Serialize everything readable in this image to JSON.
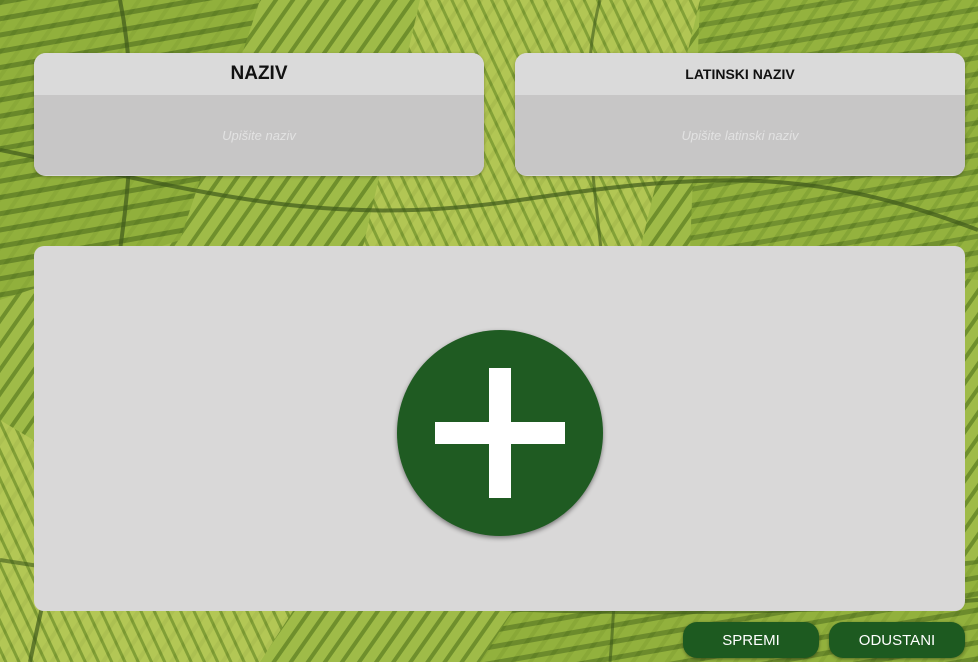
{
  "fields": {
    "name": {
      "header": "NAZIV",
      "placeholder": "Upišite naziv",
      "value": ""
    },
    "latin_name": {
      "header": "LATINSKI NAZIV",
      "placeholder": "Upišite latinski naziv",
      "value": ""
    }
  },
  "image_area": {
    "add_icon": "plus-icon"
  },
  "actions": {
    "save_label": "SPREMI",
    "cancel_label": "ODUSTANI"
  },
  "colors": {
    "accent_green": "#1f5b22",
    "card_header": "#dadada",
    "input_bg": "#c7c6c6",
    "panel_bg": "#d9d8d8"
  }
}
